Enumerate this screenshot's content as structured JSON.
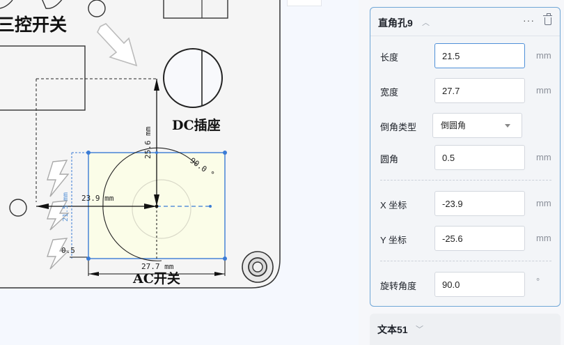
{
  "canvas": {
    "labels": {
      "three_way_switch": "三控开关",
      "dc_socket": "DC插座",
      "ac_switch": "AC开关"
    },
    "dimensions": {
      "height_dim": "25.6 mm",
      "width_dim": "27.7 mm",
      "x_offset": "23.9 mm",
      "side_dim": "21.5 mm",
      "angle": "90.0 °",
      "radius": "0.5"
    }
  },
  "panel": {
    "title": "直角孔9",
    "rows": {
      "length": {
        "label": "长度",
        "value": "21.5",
        "unit": "mm"
      },
      "width": {
        "label": "宽度",
        "value": "27.7",
        "unit": "mm"
      },
      "chamfer_type": {
        "label": "倒角类型",
        "value": "倒圆角"
      },
      "fillet": {
        "label": "圆角",
        "value": "0.5",
        "unit": "mm"
      },
      "x": {
        "label": "X 坐标",
        "value": "-23.9",
        "unit": "mm"
      },
      "y": {
        "label": "Y 坐标",
        "value": "-25.6",
        "unit": "mm"
      },
      "rotation": {
        "label": "旋转角度",
        "value": "90.0",
        "unit": "°"
      }
    }
  },
  "collapsed_panel": {
    "title": "文本51"
  },
  "colors": {
    "accent": "#4e8fd8",
    "selection_fill": "#fbfde8",
    "selection_stroke": "#3a7bd5"
  }
}
